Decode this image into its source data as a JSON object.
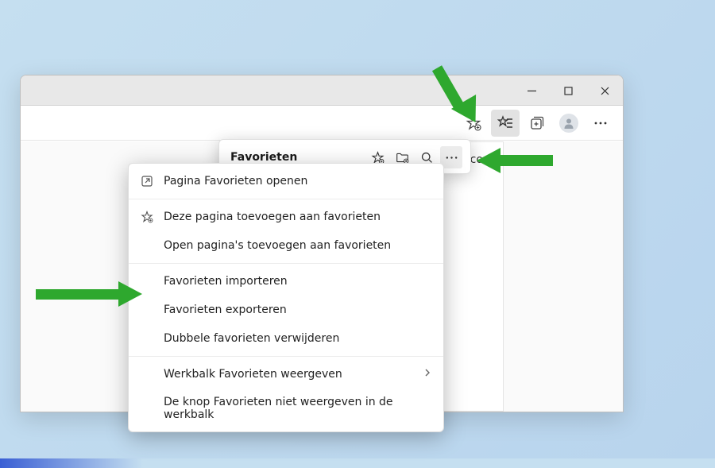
{
  "favorites": {
    "title": "Favorieten",
    "behind_text": "n co..."
  },
  "menu": {
    "open_page": "Pagina Favorieten openen",
    "add_this": "Deze pagina toevoegen aan favorieten",
    "add_open": "Open pagina's toevoegen aan favorieten",
    "import": "Favorieten importeren",
    "export": "Favorieten exporteren",
    "remove_dupes": "Dubbele favorieten verwijderen",
    "show_toolbar": "Werkbalk Favorieten weergeven",
    "hide_button": "De knop Favorieten niet weergeven in de werkbalk"
  }
}
